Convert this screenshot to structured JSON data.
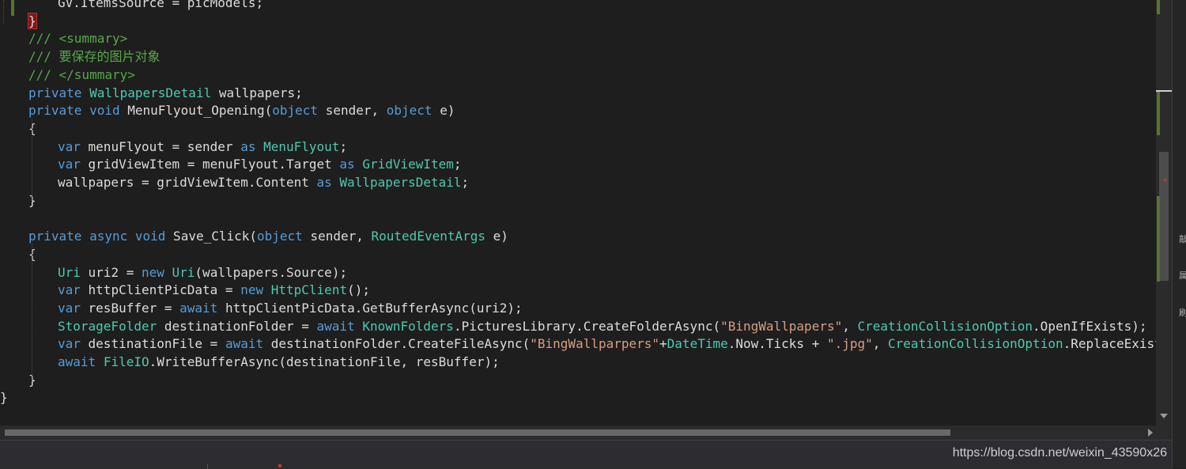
{
  "theme": {
    "background": "#1e1e1e",
    "keyword": "#569cd6",
    "type": "#4ec9b0",
    "string": "#d69d85",
    "comment": "#57a64a",
    "doc_tag": "#608b4e",
    "default": "#dcdcdc",
    "brace_highlight": "#7a1a1a",
    "change_bar_saved": "#577430"
  },
  "code": {
    "lines": [
      [
        [
          "GV.ItemsSource = picModels;",
          "default"
        ]
      ],
      [
        [
          "}",
          "default"
        ]
      ],
      [
        [
          "/// <summary>",
          "comment"
        ]
      ],
      [
        [
          "/// 要保存的图片对象",
          "comment"
        ]
      ],
      [
        [
          "/// </summary>",
          "comment"
        ]
      ],
      [
        [
          "private",
          "keyword"
        ],
        [
          " ",
          "default"
        ],
        [
          "WallpapersDetail",
          "type"
        ],
        [
          " wallpapers;",
          "default"
        ]
      ],
      [
        [
          "private",
          "keyword"
        ],
        [
          " ",
          "default"
        ],
        [
          "void",
          "keyword"
        ],
        [
          " MenuFlyout_Opening(",
          "default"
        ],
        [
          "object",
          "keyword"
        ],
        [
          " sender, ",
          "default"
        ],
        [
          "object",
          "keyword"
        ],
        [
          " e)",
          "default"
        ]
      ],
      [
        [
          "{",
          "default"
        ]
      ],
      [
        [
          "var",
          "keyword"
        ],
        [
          " menuFlyout = sender ",
          "default"
        ],
        [
          "as",
          "keyword"
        ],
        [
          " ",
          "default"
        ],
        [
          "MenuFlyout",
          "type"
        ],
        [
          ";",
          "default"
        ]
      ],
      [
        [
          "var",
          "keyword"
        ],
        [
          " gridViewItem = menuFlyout.Target ",
          "default"
        ],
        [
          "as",
          "keyword"
        ],
        [
          " ",
          "default"
        ],
        [
          "GridViewItem",
          "type"
        ],
        [
          ";",
          "default"
        ]
      ],
      [
        [
          "wallpapers = gridViewItem.Content ",
          "default"
        ],
        [
          "as",
          "keyword"
        ],
        [
          " ",
          "default"
        ],
        [
          "WallpapersDetail",
          "type"
        ],
        [
          ";",
          "default"
        ]
      ],
      [
        [
          "}",
          "default"
        ]
      ],
      [],
      [
        [
          "private",
          "keyword"
        ],
        [
          " ",
          "default"
        ],
        [
          "async",
          "keyword"
        ],
        [
          " ",
          "default"
        ],
        [
          "void",
          "keyword"
        ],
        [
          " Save_Click(",
          "default"
        ],
        [
          "object",
          "keyword"
        ],
        [
          " sender, ",
          "default"
        ],
        [
          "RoutedEventArgs",
          "type"
        ],
        [
          " e)",
          "default"
        ]
      ],
      [
        [
          "{",
          "default"
        ]
      ],
      [
        [
          "Uri",
          "type"
        ],
        [
          " uri2 = ",
          "default"
        ],
        [
          "new",
          "keyword"
        ],
        [
          " ",
          "default"
        ],
        [
          "Uri",
          "type"
        ],
        [
          "(wallpapers.Source);",
          "default"
        ]
      ],
      [
        [
          "var",
          "keyword"
        ],
        [
          " httpClientPicData = ",
          "default"
        ],
        [
          "new",
          "keyword"
        ],
        [
          " ",
          "default"
        ],
        [
          "HttpClient",
          "type"
        ],
        [
          "();",
          "default"
        ]
      ],
      [
        [
          "var",
          "keyword"
        ],
        [
          " resBuffer = ",
          "default"
        ],
        [
          "await",
          "keyword"
        ],
        [
          " httpClientPicData.GetBufferAsync(uri2);",
          "default"
        ]
      ],
      [
        [
          "StorageFolder",
          "type"
        ],
        [
          " destinationFolder = ",
          "default"
        ],
        [
          "await",
          "keyword"
        ],
        [
          " ",
          "default"
        ],
        [
          "KnownFolders",
          "type"
        ],
        [
          ".PicturesLibrary.CreateFolderAsync(",
          "default"
        ],
        [
          "\"BingWallpapers\"",
          "string"
        ],
        [
          ", ",
          "default"
        ],
        [
          "CreationCollisionOption",
          "type"
        ],
        [
          ".OpenIfExists);",
          "default"
        ]
      ],
      [
        [
          "var",
          "keyword"
        ],
        [
          " destinationFile = ",
          "default"
        ],
        [
          "await",
          "keyword"
        ],
        [
          " destinationFolder.CreateFileAsync(",
          "default"
        ],
        [
          "\"BingWallparpers\"",
          "string"
        ],
        [
          "+",
          "default"
        ],
        [
          "DateTime",
          "type"
        ],
        [
          ".Now.Ticks + ",
          "default"
        ],
        [
          "\".jpg\"",
          "string"
        ],
        [
          ", ",
          "default"
        ],
        [
          "CreationCollisionOption",
          "type"
        ],
        [
          ".ReplaceExisting);",
          "default"
        ]
      ],
      [
        [
          "await",
          "keyword"
        ],
        [
          " ",
          "default"
        ],
        [
          "FileIO",
          "type"
        ],
        [
          ".WriteBufferAsync(destinationFile, resBuffer);",
          "default"
        ]
      ],
      [
        [
          "}",
          "default"
        ]
      ],
      [
        [
          "}",
          "default"
        ]
      ]
    ]
  },
  "side_icons": [
    "敲",
    "属",
    "刷"
  ],
  "watermark": "https://blog.csdn.net/weixin_43590x26"
}
